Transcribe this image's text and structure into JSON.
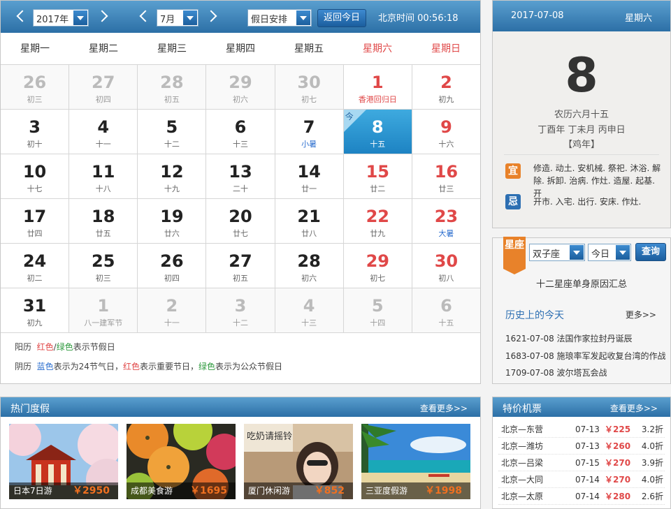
{
  "header": {
    "year": "2017年",
    "month": "7月",
    "holiday_select": "假日安排",
    "today_button": "返回今日",
    "beijing_time": "北京时间  00:56:18"
  },
  "weekdays": [
    "星期一",
    "星期二",
    "星期三",
    "星期四",
    "星期五",
    "星期六",
    "星期日"
  ],
  "weeks": [
    [
      {
        "n": "26",
        "l": "初三",
        "other": true
      },
      {
        "n": "27",
        "l": "初四",
        "other": true
      },
      {
        "n": "28",
        "l": "初五",
        "other": true
      },
      {
        "n": "29",
        "l": "初六",
        "other": true
      },
      {
        "n": "30",
        "l": "初七",
        "other": true
      },
      {
        "n": "1",
        "l": "香港回归日",
        "nr": true,
        "lc": "red"
      },
      {
        "n": "2",
        "l": "初九",
        "nr": true
      }
    ],
    [
      {
        "n": "3",
        "l": "初十"
      },
      {
        "n": "4",
        "l": "十一"
      },
      {
        "n": "5",
        "l": "十二"
      },
      {
        "n": "6",
        "l": "十三"
      },
      {
        "n": "7",
        "l": "小暑",
        "lc": "blue"
      },
      {
        "n": "8",
        "l": "十五",
        "today": true
      },
      {
        "n": "9",
        "l": "十六",
        "nr": true
      }
    ],
    [
      {
        "n": "10",
        "l": "十七"
      },
      {
        "n": "11",
        "l": "十八"
      },
      {
        "n": "12",
        "l": "十九"
      },
      {
        "n": "13",
        "l": "二十"
      },
      {
        "n": "14",
        "l": "廿一"
      },
      {
        "n": "15",
        "l": "廿二",
        "nr": true
      },
      {
        "n": "16",
        "l": "廿三",
        "nr": true
      }
    ],
    [
      {
        "n": "17",
        "l": "廿四"
      },
      {
        "n": "18",
        "l": "廿五"
      },
      {
        "n": "19",
        "l": "廿六"
      },
      {
        "n": "20",
        "l": "廿七"
      },
      {
        "n": "21",
        "l": "廿八"
      },
      {
        "n": "22",
        "l": "廿九",
        "nr": true
      },
      {
        "n": "23",
        "l": "大暑",
        "nr": true,
        "lc": "blue"
      }
    ],
    [
      {
        "n": "24",
        "l": "初二"
      },
      {
        "n": "25",
        "l": "初三"
      },
      {
        "n": "26",
        "l": "初四"
      },
      {
        "n": "27",
        "l": "初五"
      },
      {
        "n": "28",
        "l": "初六"
      },
      {
        "n": "29",
        "l": "初七",
        "nr": true
      },
      {
        "n": "30",
        "l": "初八",
        "nr": true
      }
    ],
    [
      {
        "n": "31",
        "l": "初九"
      },
      {
        "n": "1",
        "l": "八一建军节",
        "other": true
      },
      {
        "n": "2",
        "l": "十一",
        "other": true
      },
      {
        "n": "3",
        "l": "十二",
        "other": true
      },
      {
        "n": "4",
        "l": "十三",
        "other": true
      },
      {
        "n": "5",
        "l": "十四",
        "other": true
      },
      {
        "n": "6",
        "l": "十五",
        "other": true
      }
    ]
  ],
  "today_mark": "今",
  "legend": {
    "solar_prefix": "阳历",
    "red": "红色",
    "slash": "/",
    "green": "绿色",
    "solar_suffix": "表示节假日",
    "lunar_prefix": "阴历",
    "blue": "蓝色",
    "lunar_mid1": "表示为24节气日，",
    "lunar_mid2": "表示重要节日，",
    "lunar_suffix": "表示为公众节假日"
  },
  "day_panel": {
    "date": "2017-07-08",
    "weekday": "星期六",
    "big_day": "8",
    "lunar": "农历六月十五",
    "ganzhi": "丁酉年  丁未月  丙申日",
    "zodiac": "【鸡年】",
    "yi_label": "宜",
    "yi_text": "修造. 动土. 安机械. 祭祀. 沐浴. 解除. 拆卸. 治病. 作灶. 造屋. 起基. 开",
    "ji_label": "忌",
    "ji_text": "开市. 入宅. 出行. 安床. 作灶."
  },
  "astro": {
    "badge": "星座",
    "sign": "双子座",
    "day": "今日",
    "query": "查询",
    "link": "十二星座单身原因汇总",
    "history_title": "历史上的今天",
    "history_more": "更多>>",
    "history": [
      "1621-07-08 法国作家拉封丹诞辰",
      "1683-07-08 施琅率军发起收复台湾的作战",
      "1709-07-08 波尔塔瓦会战"
    ]
  },
  "hot": {
    "title": "热门度假",
    "more": "查看更多>>",
    "tiles": [
      {
        "name": "日本7日游",
        "price": "￥2950"
      },
      {
        "name": "成都美食游",
        "price": "￥1695"
      },
      {
        "name": "厦门休闲游",
        "price": "￥852"
      },
      {
        "name": "三亚度假游",
        "price": "￥1998"
      }
    ],
    "sign_text": "吃奶请摇铃"
  },
  "flights": {
    "title": "特价机票",
    "more": "查看更多>>",
    "items": [
      {
        "route": "北京—东营",
        "date": "07-13",
        "price": "￥225",
        "disc": "3.2折"
      },
      {
        "route": "北京—潍坊",
        "date": "07-13",
        "price": "￥260",
        "disc": "4.0折"
      },
      {
        "route": "北京—吕梁",
        "date": "07-15",
        "price": "￥270",
        "disc": "3.9折"
      },
      {
        "route": "北京—大同",
        "date": "07-14",
        "price": "￥270",
        "disc": "4.0折"
      },
      {
        "route": "北京—太原",
        "date": "07-14",
        "price": "￥280",
        "disc": "2.6折"
      }
    ]
  },
  "colors": {
    "header_blue": "#2c6fa6",
    "holiday_red": "#e04848",
    "solar_term_blue": "#2d6fcf",
    "today_blue": "#1d83c3",
    "yi_orange": "#e8822a",
    "ji_blue": "#2d6fb2",
    "price_orange": "#f07020"
  }
}
